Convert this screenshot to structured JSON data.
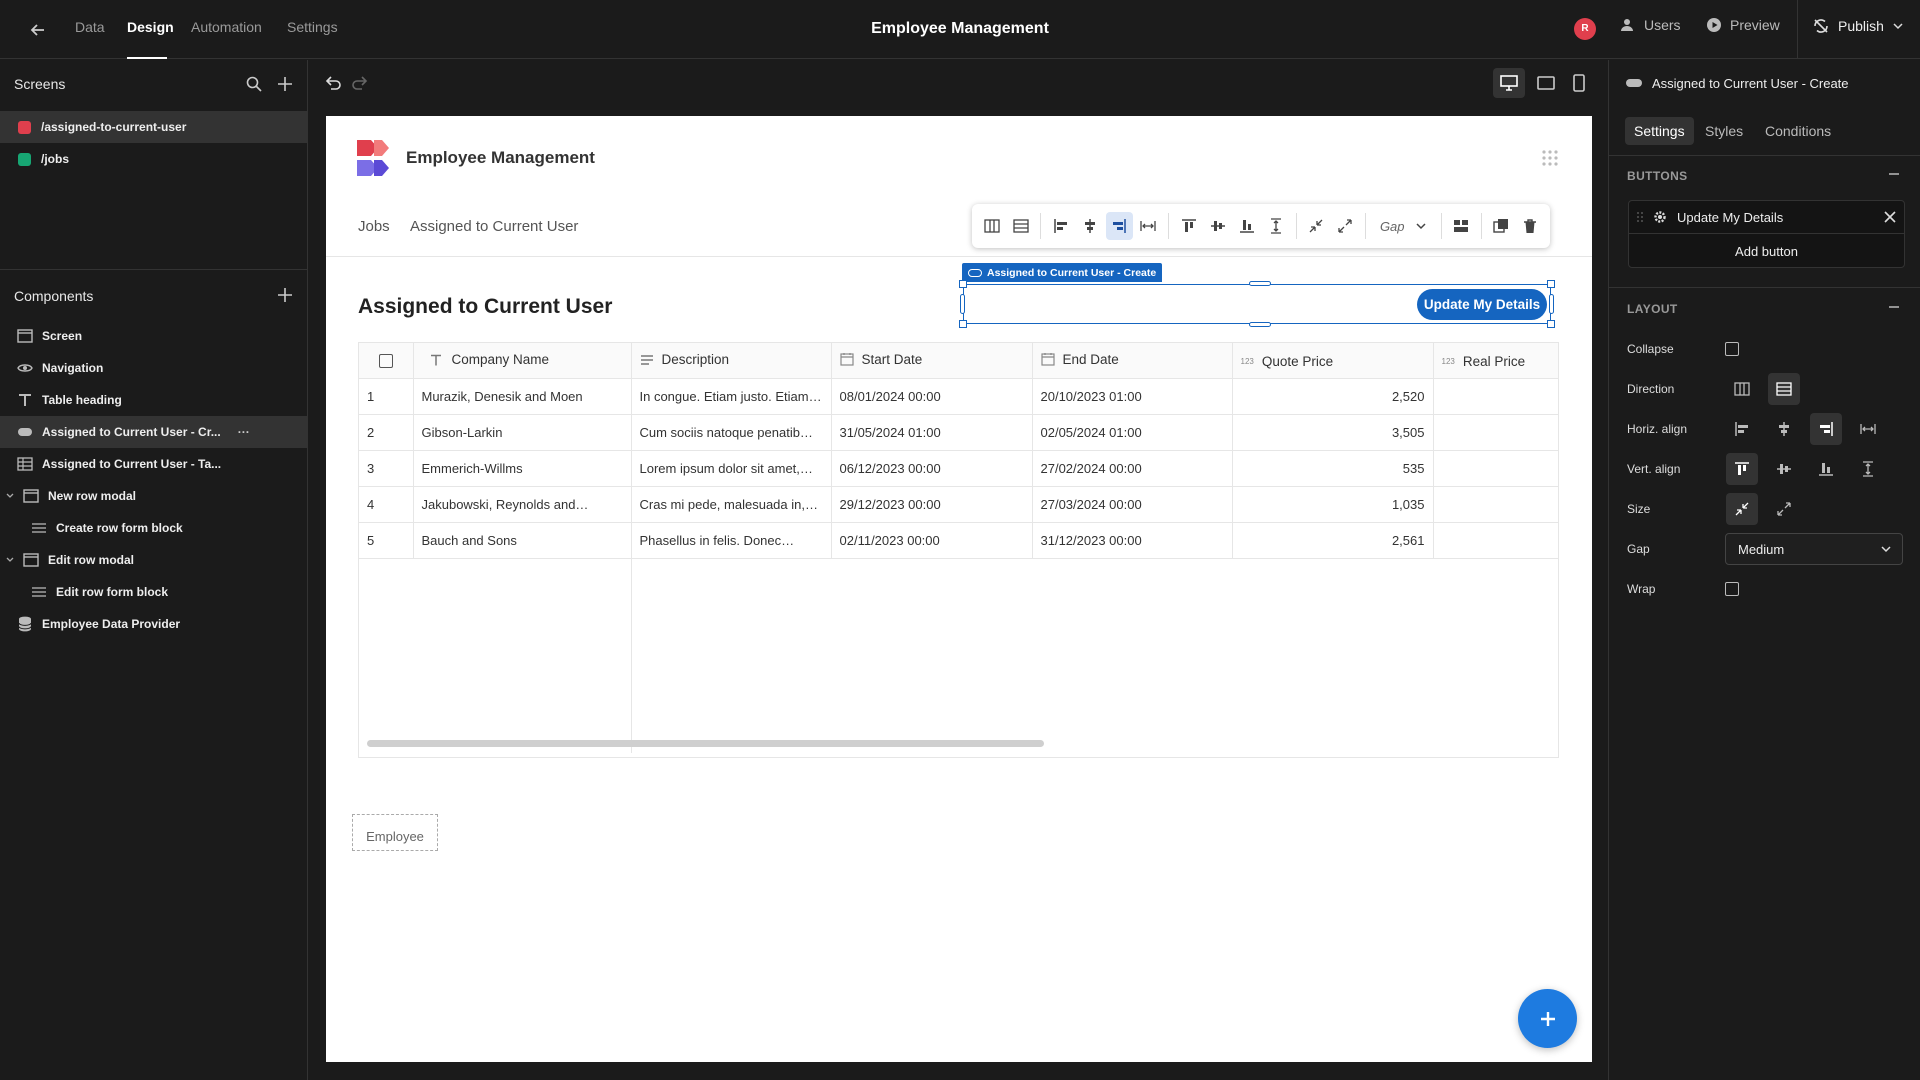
{
  "topbar": {
    "tabs": [
      "Data",
      "Design",
      "Automation",
      "Settings"
    ],
    "app_title": "Employee Management",
    "user_initial": "R",
    "users_label": "Users",
    "preview_label": "Preview",
    "publish_label": "Publish"
  },
  "left": {
    "screens_title": "Screens",
    "screens": [
      {
        "path": "/assigned-to-current-user",
        "color": "#e03f4d"
      },
      {
        "path": "/jobs",
        "color": "#17a673"
      }
    ],
    "components_title": "Components",
    "components": [
      {
        "label": "Screen",
        "icon": "screen-icon"
      },
      {
        "label": "Navigation",
        "icon": "eye-icon"
      },
      {
        "label": "Table heading",
        "icon": "text-icon"
      },
      {
        "label": "Assigned to Current User - Cr...",
        "icon": "button-icon"
      },
      {
        "label": "Assigned to Current User - Ta...",
        "icon": "table-icon"
      },
      {
        "label": "New row modal",
        "icon": "modal-icon"
      },
      {
        "label": "Create row form block",
        "icon": "form-icon"
      },
      {
        "label": "Edit row modal",
        "icon": "modal-icon"
      },
      {
        "label": "Edit row form block",
        "icon": "form-icon"
      },
      {
        "label": "Employee Data Provider",
        "icon": "database-icon"
      }
    ]
  },
  "preview": {
    "brand": "Employee Management",
    "nav": [
      "Jobs",
      "Assigned to Current User"
    ],
    "heading": "Assigned to Current User",
    "selected_tag": "Assigned to Current User - Create",
    "button_label": "Update My Details",
    "toolbar_gap": "Gap",
    "placeholder_label": "Employee",
    "columns": [
      "Company Name",
      "Description",
      "Start Date",
      "End Date",
      "Quote Price",
      "Real Price"
    ],
    "rows": [
      [
        "1",
        "Murazik, Denesik and Moen",
        "In congue. Etiam justo. Etiam…",
        "08/01/2024 00:00",
        "20/10/2023 01:00",
        "2,520",
        ""
      ],
      [
        "2",
        "Gibson-Larkin",
        "Cum sociis natoque penatib…",
        "31/05/2024 01:00",
        "02/05/2024 01:00",
        "3,505",
        ""
      ],
      [
        "3",
        "Emmerich-Willms",
        "Lorem ipsum dolor sit amet,…",
        "06/12/2023 00:00",
        "27/02/2024 00:00",
        "535",
        ""
      ],
      [
        "4",
        "Jakubowski, Reynolds and…",
        "Cras mi pede, malesuada in,…",
        "29/12/2023 00:00",
        "27/03/2024 00:00",
        "1,035",
        ""
      ],
      [
        "5",
        "Bauch and Sons",
        "Phasellus in felis. Donec…",
        "02/11/2023 00:00",
        "31/12/2023 00:00",
        "2,561",
        ""
      ]
    ]
  },
  "right": {
    "component_title": "Assigned to Current User - Create",
    "tabs": [
      "Settings",
      "Styles",
      "Conditions"
    ],
    "buttons_section": "BUTTONS",
    "button_item": "Update My Details",
    "add_button": "Add button",
    "layout_section": "LAYOUT",
    "labels": {
      "collapse": "Collapse",
      "direction": "Direction",
      "horiz": "Horiz. align",
      "vert": "Vert. align",
      "size": "Size",
      "gap": "Gap",
      "wrap": "Wrap"
    },
    "gap_value": "Medium"
  },
  "colors": {
    "accent": "#1565c0",
    "selection": "#2f6fd6"
  }
}
